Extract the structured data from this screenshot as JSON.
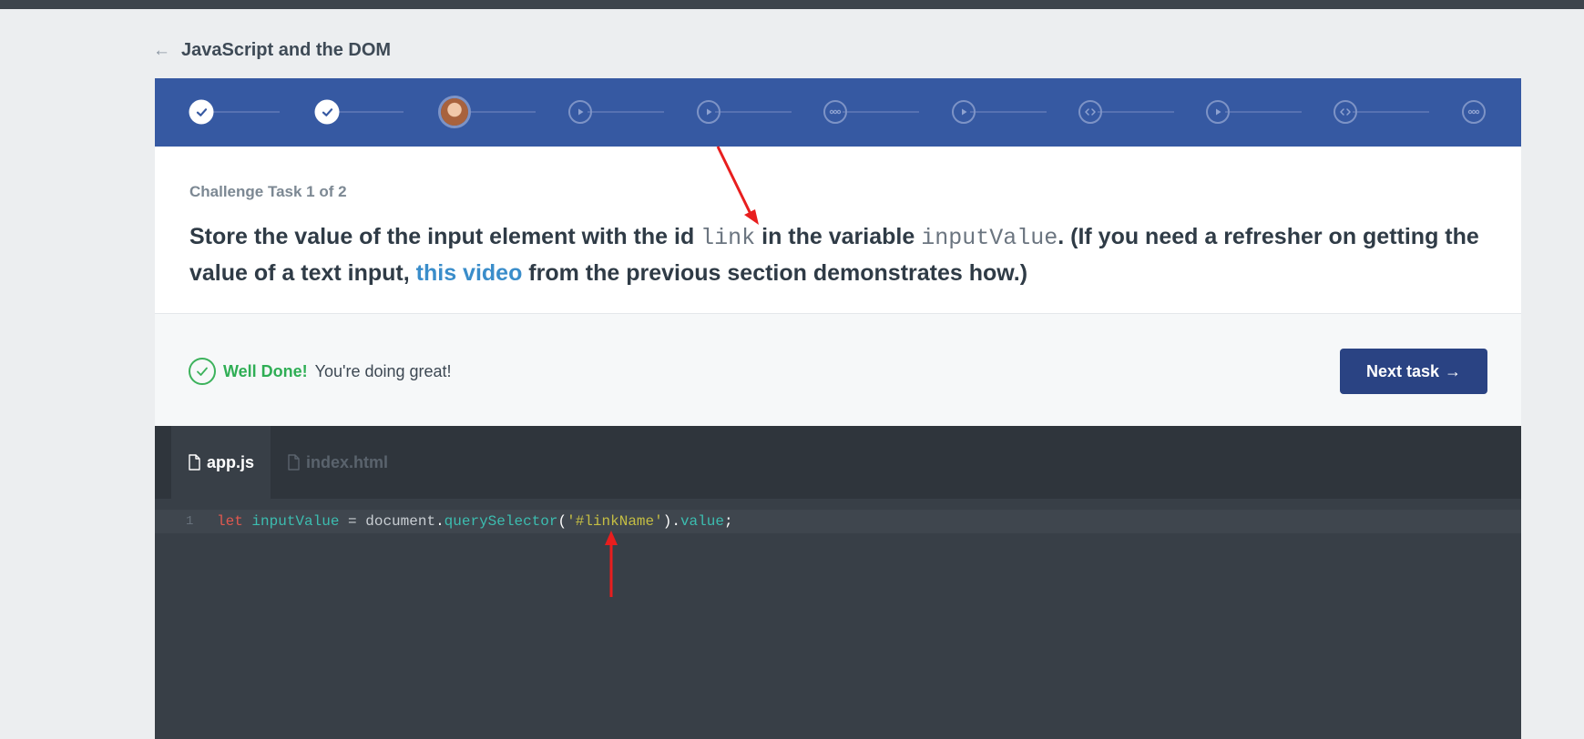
{
  "course": {
    "back_arrow": "←",
    "title": "JavaScript and the DOM"
  },
  "stepper": {
    "steps": [
      {
        "kind": "done",
        "icon": "check-icon"
      },
      {
        "kind": "done",
        "icon": "check-icon"
      },
      {
        "kind": "current",
        "icon": "avatar"
      },
      {
        "kind": "video",
        "icon": "play-icon"
      },
      {
        "kind": "video",
        "icon": "play-icon"
      },
      {
        "kind": "quiz",
        "icon": "dots-icon"
      },
      {
        "kind": "video",
        "icon": "play-icon"
      },
      {
        "kind": "code",
        "icon": "code-icon"
      },
      {
        "kind": "video",
        "icon": "play-icon"
      },
      {
        "kind": "code",
        "icon": "code-icon"
      },
      {
        "kind": "quiz",
        "icon": "dots-icon"
      }
    ]
  },
  "task": {
    "label": "Challenge Task 1 of 2",
    "text_part1": "Store the value of the input element with the id ",
    "code_id": "link",
    "text_part2": " in the variable ",
    "code_var": "inputValue",
    "text_part3": ". (If you need a refresher on getting the value of a text input, ",
    "link_text": "this video",
    "text_part4": " from the previous section demonstrates how.)"
  },
  "feedback": {
    "well_done": "Well Done!",
    "message": " You're doing great!",
    "next_button": "Next task",
    "next_arrow": "→"
  },
  "editor": {
    "tabs": [
      {
        "label": "app.js",
        "active": true
      },
      {
        "label": "index.html",
        "active": false
      }
    ],
    "line_number": "1",
    "tokens": {
      "kw": "let",
      "var": "inputValue",
      "eq": " = ",
      "obj": "document",
      "dot1": ".",
      "method": "querySelector",
      "open": "(",
      "str": "'#linkName'",
      "close": ")",
      "dot2": ".",
      "prop": "value",
      "semi": ";"
    }
  },
  "colors": {
    "accent": "#3659a2",
    "button": "#2a4383",
    "success": "#2fae55",
    "annotation_arrow": "#e81e1e"
  }
}
